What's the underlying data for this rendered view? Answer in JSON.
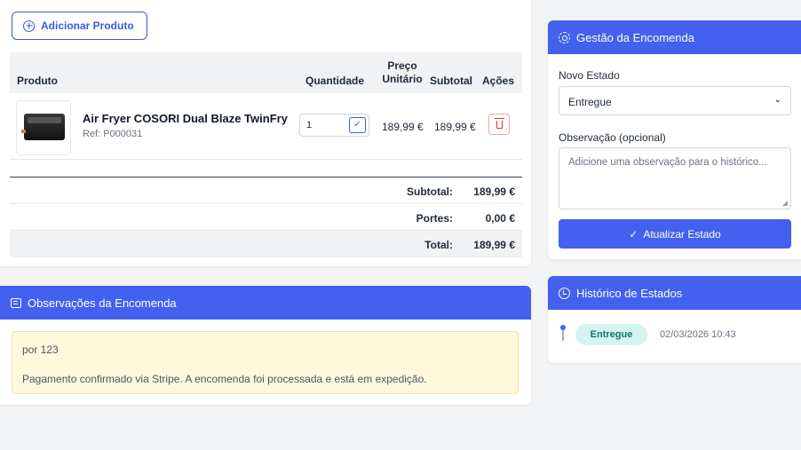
{
  "products": {
    "add_button_label": "Adicionar Produto",
    "columns": {
      "produto": "Produto",
      "quantidade": "Quantidade",
      "preco": "Preço\nUnitário",
      "subtotal": "Subtotal",
      "acoes": "Ações"
    },
    "rows": [
      {
        "name": "Air Fryer COSORI Dual Blaze TwinFry",
        "ref": "Ref: P000031",
        "quantity": "1",
        "unit_price": "189,99 €",
        "subtotal": "189,99 €"
      }
    ],
    "totals": {
      "subtotal_label": "Subtotal:",
      "subtotal_value": "189,99 €",
      "portes_label": "Portes:",
      "portes_value": "0,00 €",
      "total_label": "Total:",
      "total_value": "189,99 €"
    }
  },
  "notes": {
    "title": "Observações da Encomenda",
    "lines": [
      "por 123",
      "Pagamento confirmado via Stripe. A encomenda foi processada e está em expedição."
    ]
  },
  "gestao": {
    "title": "Gestão da Encomenda",
    "novo_estado_label": "Novo Estado",
    "novo_estado_value": "Entregue",
    "observacao_label": "Observação (opcional)",
    "observacao_placeholder": "Adicione uma observação para o histórico...",
    "update_button_label": "Atualizar Estado"
  },
  "historico": {
    "title": "Histórico de Estados",
    "entries": [
      {
        "status": "Entregue",
        "datetime": "02/03/2026 10:43"
      }
    ]
  },
  "colors": {
    "accent": "#4361ee",
    "badge_bg": "#d3f4ef",
    "note_bg": "#fff8db",
    "danger": "#e03131"
  }
}
